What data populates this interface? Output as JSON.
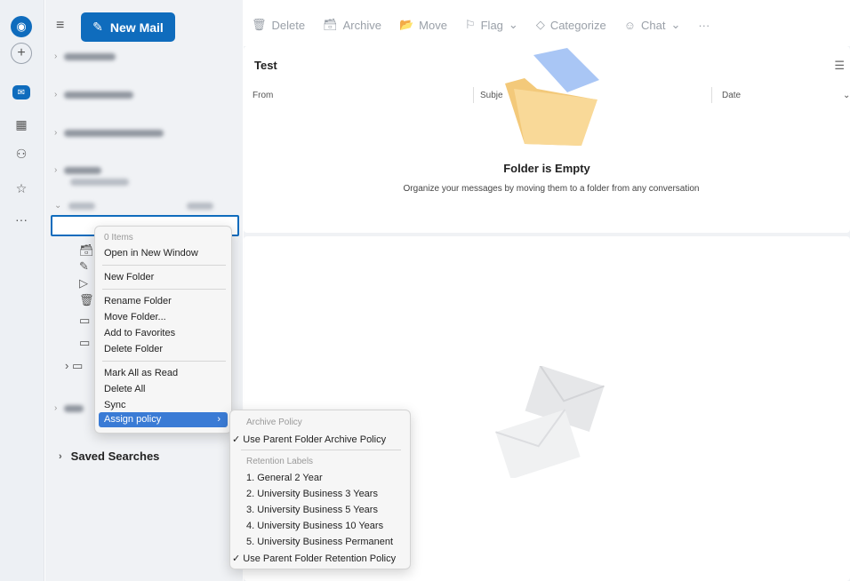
{
  "toolbar": {
    "new_mail": "New Mail",
    "items": [
      {
        "label": "Delete",
        "icon": "🗑"
      },
      {
        "label": "Archive",
        "icon": "🗃"
      },
      {
        "label": "Move",
        "icon": "📂"
      },
      {
        "label": "Flag",
        "icon": "⚐"
      },
      {
        "label": "Categorize",
        "icon": "◇"
      },
      {
        "label": "Chat",
        "icon": "☺"
      }
    ],
    "more": "···"
  },
  "folder_pane": {
    "saved_searches": "Saved Searches"
  },
  "list": {
    "title": "Test",
    "col_from": "From",
    "col_subject": "Subje",
    "col_date": "Date",
    "empty_title": "Folder is Empty",
    "empty_sub": "Organize your messages by moving them to a folder from any conversation"
  },
  "context_menu": {
    "count": "0 Items",
    "open_new_window": "Open in New Window",
    "new_folder": "New Folder",
    "rename_folder": "Rename Folder",
    "move_folder": "Move Folder...",
    "add_favorites": "Add to Favorites",
    "delete_folder": "Delete Folder",
    "mark_all_read": "Mark All as Read",
    "delete_all": "Delete All",
    "sync": "Sync",
    "assign_policy": "Assign policy"
  },
  "submenu": {
    "archive_header": "Archive Policy",
    "use_parent_archive": "Use Parent Folder Archive Policy",
    "retention_header": "Retention Labels",
    "labels": [
      "1. General 2 Year",
      "2. University Business 3 Years",
      "3. University Business 5 Years",
      "4. University Business 10 Years",
      "5. University Business Permanent"
    ],
    "use_parent_retention": "Use Parent Folder Retention Policy"
  },
  "colors": {
    "accent": "#0f6cbd",
    "highlight": "#3a7bd5"
  }
}
